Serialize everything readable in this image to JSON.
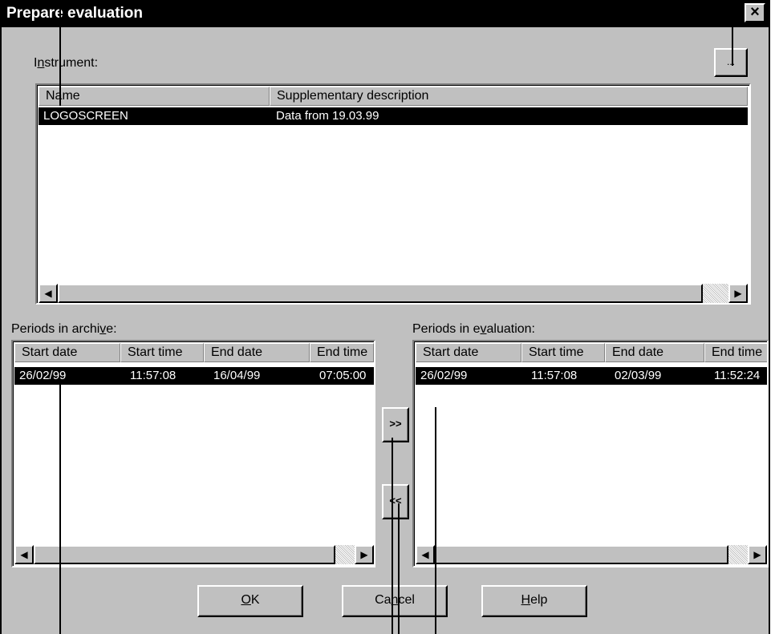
{
  "dialog": {
    "title": "Prepare evaluation",
    "close_glyph": "×"
  },
  "instrument": {
    "label_pre": "I",
    "label_ul": "n",
    "label_post": "strument:",
    "browse_label": "...",
    "columns": [
      "Name",
      "Supplementary description"
    ],
    "rows": [
      {
        "name": "LOGOSCREEN",
        "description": "Data from 19.03.99"
      }
    ]
  },
  "archive": {
    "label_pre": "Periods in archi",
    "label_ul": "v",
    "label_post": "e:",
    "columns": [
      "Start date",
      "Start time",
      "End date",
      "End time"
    ],
    "rows": [
      {
        "start_date": "26/02/99",
        "start_time": "11:57:08",
        "end_date": "16/04/99",
        "end_time": "07:05:00"
      }
    ]
  },
  "evaluation": {
    "label_pre": "Periods in e",
    "label_ul": "v",
    "label_post": "aluation:",
    "columns": [
      "Start date",
      "Start time",
      "End date",
      "End time"
    ],
    "rows": [
      {
        "start_date": "26/02/99",
        "start_time": "11:57:08",
        "end_date": "02/03/99",
        "end_time": "11:52:24"
      }
    ]
  },
  "transfer": {
    "add_label": ">>",
    "remove_label": "<<"
  },
  "buttons": {
    "ok_ul": "O",
    "ok_post": "K",
    "cancel_pre": "Ca",
    "cancel_ul": "n",
    "cancel_post": "cel",
    "help_ul": "H",
    "help_post": "elp"
  },
  "icons": {
    "scroll_left": "◀",
    "scroll_right": "▶"
  }
}
